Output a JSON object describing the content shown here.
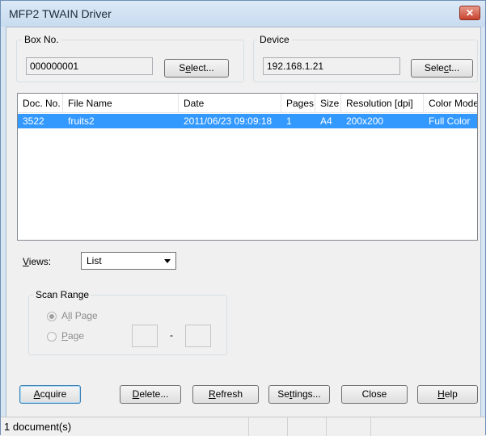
{
  "window": {
    "title": "MFP2 TWAIN Driver",
    "close_glyph": "✕"
  },
  "box": {
    "legend": "Box No.",
    "value": "000000001",
    "select_pre": "S",
    "select_ul": "e",
    "select_post": "lect..."
  },
  "device": {
    "legend": "Device",
    "value": "192.168.1.21",
    "select_pre": "Sele",
    "select_ul": "c",
    "select_post": "t..."
  },
  "list": {
    "columns": [
      "Doc. No.",
      "File Name",
      "Date",
      "Pages",
      "Size",
      "Resolution [dpi]",
      "Color Mode"
    ],
    "rows": [
      {
        "doc_no": "3522",
        "file_name": "fruits2",
        "date": "2011/06/23 09:09:18",
        "pages": "1",
        "size": "A4",
        "resolution": "200x200",
        "color_mode": "Full Color"
      }
    ]
  },
  "views": {
    "label_ul": "V",
    "label_rest": "iews:",
    "selected": "List"
  },
  "scan_range": {
    "legend": "Scan Range",
    "all_page_pre": "A",
    "all_page_ul": "l",
    "all_page_post": "l Page",
    "page_ul": "P",
    "page_rest": "age",
    "separator": "-"
  },
  "buttons": {
    "acquire_ul": "A",
    "acquire_rest": "cquire",
    "delete_ul": "D",
    "delete_rest": "elete...",
    "refresh_ul": "R",
    "refresh_rest": "efresh",
    "settings_pre": "Se",
    "settings_ul": "t",
    "settings_post": "tings...",
    "close": "Close",
    "help_ul": "H",
    "help_rest": "elp"
  },
  "status": {
    "text": "1 document(s)"
  }
}
